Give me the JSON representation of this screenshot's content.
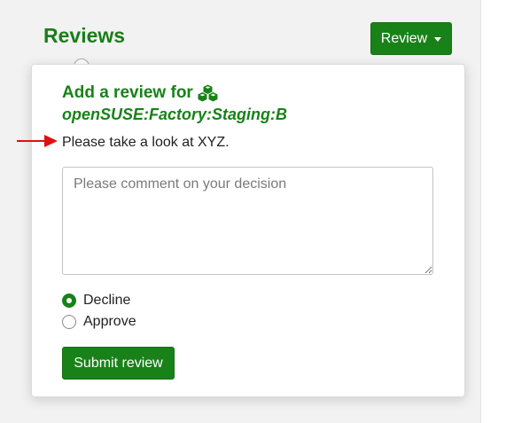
{
  "reviews_section": {
    "heading": "Reviews",
    "review_button_label": "Review"
  },
  "review_popup": {
    "title": "Add a review for",
    "project_icon": "cubes-icon",
    "project_name": "openSUSE:Factory:Staging:B",
    "description": "Please take a look at XYZ.",
    "comment_placeholder": "Please comment on your decision",
    "comment_value": "",
    "options": [
      {
        "label": "Decline",
        "selected": true
      },
      {
        "label": "Approve",
        "selected": false
      }
    ],
    "submit_label": "Submit review"
  },
  "annotation": {
    "arrow_color": "#e01010",
    "arrow_icon": "red-arrow-icon"
  },
  "colors": {
    "brand_green": "#188218",
    "page_background": "#f2f2f2"
  }
}
